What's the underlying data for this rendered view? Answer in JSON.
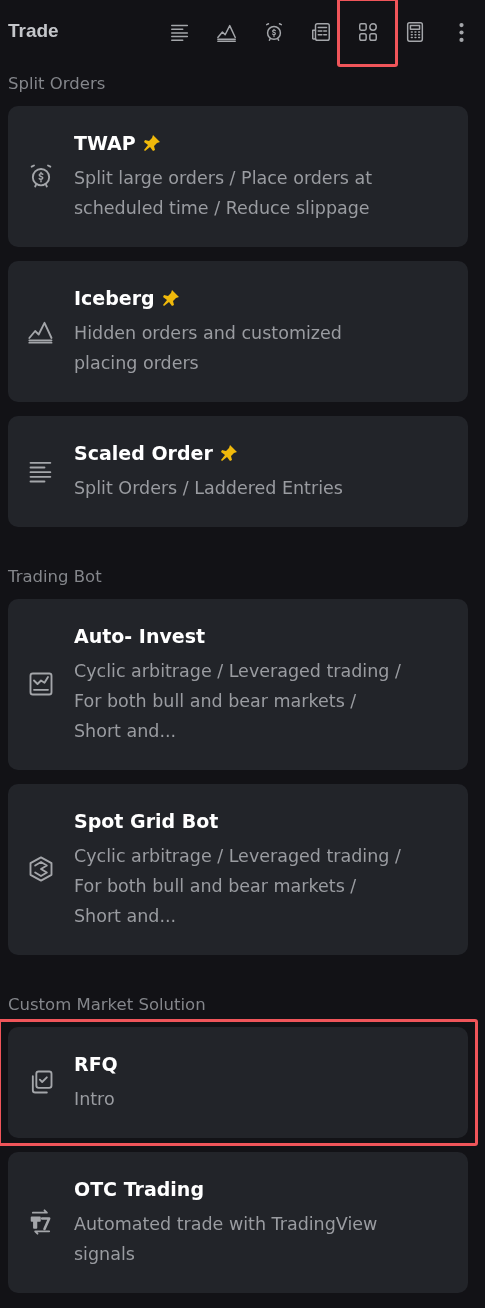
{
  "header": {
    "title": "Trade",
    "tools": [
      {
        "kind": "lines",
        "highlighted": false
      },
      {
        "kind": "mountain",
        "highlighted": false
      },
      {
        "kind": "alarm",
        "highlighted": false
      },
      {
        "kind": "news",
        "highlighted": false
      },
      {
        "kind": "apps",
        "highlighted": true
      },
      {
        "kind": "calculator",
        "highlighted": false
      },
      {
        "kind": "more",
        "highlighted": false
      }
    ]
  },
  "sections": [
    {
      "title": "Split Orders",
      "items": [
        {
          "kind": "alarm",
          "title": "TWAP",
          "pinned": true,
          "highlighted": false,
          "description": "Split large orders / Place orders at\nscheduled time / Reduce slippage"
        },
        {
          "kind": "mountain",
          "title": "Iceberg",
          "pinned": true,
          "highlighted": false,
          "description": "Hidden orders and customized\nplacing orders"
        },
        {
          "kind": "lines",
          "title": "Scaled Order",
          "pinned": true,
          "highlighted": false,
          "description": "Split Orders / Laddered Entries"
        }
      ]
    },
    {
      "title": "Trading Bot",
      "items": [
        {
          "kind": "chart",
          "title": "Auto- Invest",
          "pinned": false,
          "highlighted": false,
          "description": "Cyclic arbitrage / Leveraged trading /\nFor both bull and bear markets /\nShort and..."
        },
        {
          "kind": "hexagon",
          "title": "Spot Grid Bot",
          "pinned": false,
          "highlighted": false,
          "description": "Cyclic arbitrage / Leveraged trading /\nFor both bull and bear markets /\nShort and..."
        }
      ]
    },
    {
      "title": "Custom Market Solution",
      "items": [
        {
          "kind": "checkcopy",
          "title": "RFQ",
          "pinned": false,
          "highlighted": true,
          "description": "Intro"
        },
        {
          "kind": "exchange",
          "title": "OTC Trading",
          "pinned": false,
          "highlighted": false,
          "description": "Automated trade with TradingView\nsignals"
        }
      ]
    }
  ]
}
